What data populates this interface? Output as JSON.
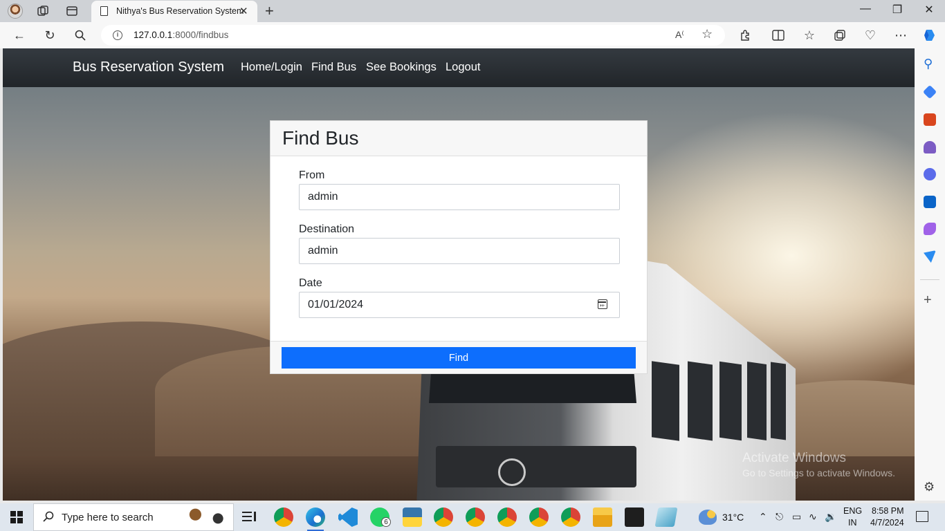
{
  "browser": {
    "tab_title": "Nithya's Bus Reservation System",
    "url_host": "127.0.0.1",
    "url_path": ":8000/findbus",
    "new_tab_glyph": "+",
    "close_glyph": "✕"
  },
  "navbar": {
    "brand": "Bus Reservation System",
    "links": [
      "Home/Login",
      "Find Bus",
      "See Bookings",
      "Logout"
    ]
  },
  "card": {
    "title": "Find Bus",
    "fields": {
      "from": {
        "label": "From",
        "value": "admin"
      },
      "destination": {
        "label": "Destination",
        "value": "admin"
      },
      "date": {
        "label": "Date",
        "value": "01/01/2024"
      }
    },
    "submit_label": "Find"
  },
  "watermark": {
    "line1": "Activate Windows",
    "line2": "Go to Settings to activate Windows."
  },
  "taskbar": {
    "search_placeholder": "Type here to search",
    "whatsapp_badge": "6",
    "weather": "31°C",
    "lang_top": "ENG",
    "lang_bottom": "IN",
    "time": "8:58 PM",
    "date": "4/7/2024"
  },
  "colors": {
    "navbar": "#212529",
    "primary_button": "#0d6efd",
    "card_header": "#f7f7f7"
  }
}
